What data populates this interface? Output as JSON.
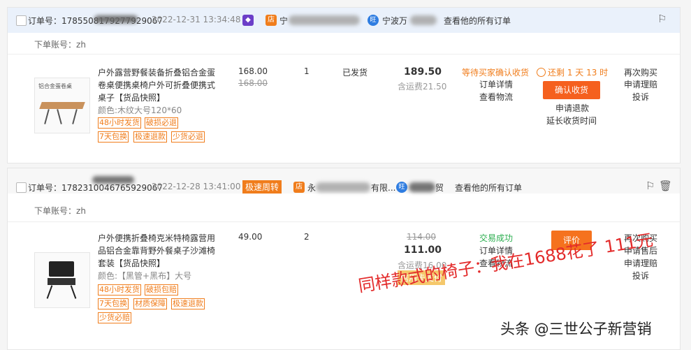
{
  "orders": [
    {
      "order_no": "订单号：1785508179277929067",
      "time": "2022-12-31 13:34:48",
      "shop_prefix": "宁",
      "buyer_prefix": "宁波万",
      "view_all": "查看他的所有订单",
      "account_label": "下单账号：",
      "account_value": "zh",
      "title": "户外露营野餐装备折叠铝合金蛋卷桌便携桌椅户外可折叠便携式桌子【货品快照】",
      "image_label": "铝合金蛋卷桌",
      "variant": "颜色:木纹大号120*60",
      "tags": [
        "48小时发货",
        "破损必退",
        "7天包换",
        "极速退款",
        "少货必退"
      ],
      "unit_price": "168.00",
      "orig_price": "168.00",
      "quantity": "1",
      "ship_status": "已发货",
      "total": "189.50",
      "freight": "含运费21.50",
      "status": "等待买家确认收货",
      "status_color": "#f07d1c",
      "links": [
        "订单详情",
        "查看物流"
      ],
      "countdown": "还剩 1 天 13 时",
      "confirm_button": "确认收货",
      "after_links": [
        "申请退款",
        "延长收货时间"
      ],
      "actions": [
        "再次购买",
        "申请理赔",
        "投诉"
      ]
    },
    {
      "order_no": "订单号：1782310046765929067",
      "time": "2022-12-28 13:41:00",
      "fast_badge": "极速周转",
      "shop_prefix": "永",
      "shop_suffix": "有限...",
      "buyer_suffix": "贸",
      "view_all": "查看他的所有订单",
      "account_label": "下单账号：",
      "account_value": "zh",
      "title": "户外便携折叠椅克米特椅露营用品铝合金靠背野外餐桌子沙滩椅套装【货品快照】",
      "variant": "颜色:【黑管+黑布】大号",
      "tags": [
        "48小时发货",
        "破损包赔",
        "7天包换",
        "材质保障",
        "极速退款",
        "少货必赔"
      ],
      "unit_price": "49.00",
      "quantity": "2",
      "orig_total": "114.00",
      "total": "111.00",
      "freight": "含运费16.00",
      "credit_badge": "信用卡支付",
      "status": "交易成功",
      "status_color": "#2bae4f",
      "links": [
        "订单详情",
        "查看物流"
      ],
      "review_button": "评价",
      "actions": [
        "再次购买",
        "申请售后",
        "申请理赔",
        "投诉"
      ]
    }
  ],
  "overlay_text": "同样款式的椅子：我在1688花了 111元",
  "watermark": "头条 @三世公子新营销",
  "colors": {
    "accent": "#f07d1c",
    "button": "#f5601e",
    "success": "#2bae4f",
    "header_bg": "#eaf1fb",
    "overlay": "#e32b2b"
  }
}
